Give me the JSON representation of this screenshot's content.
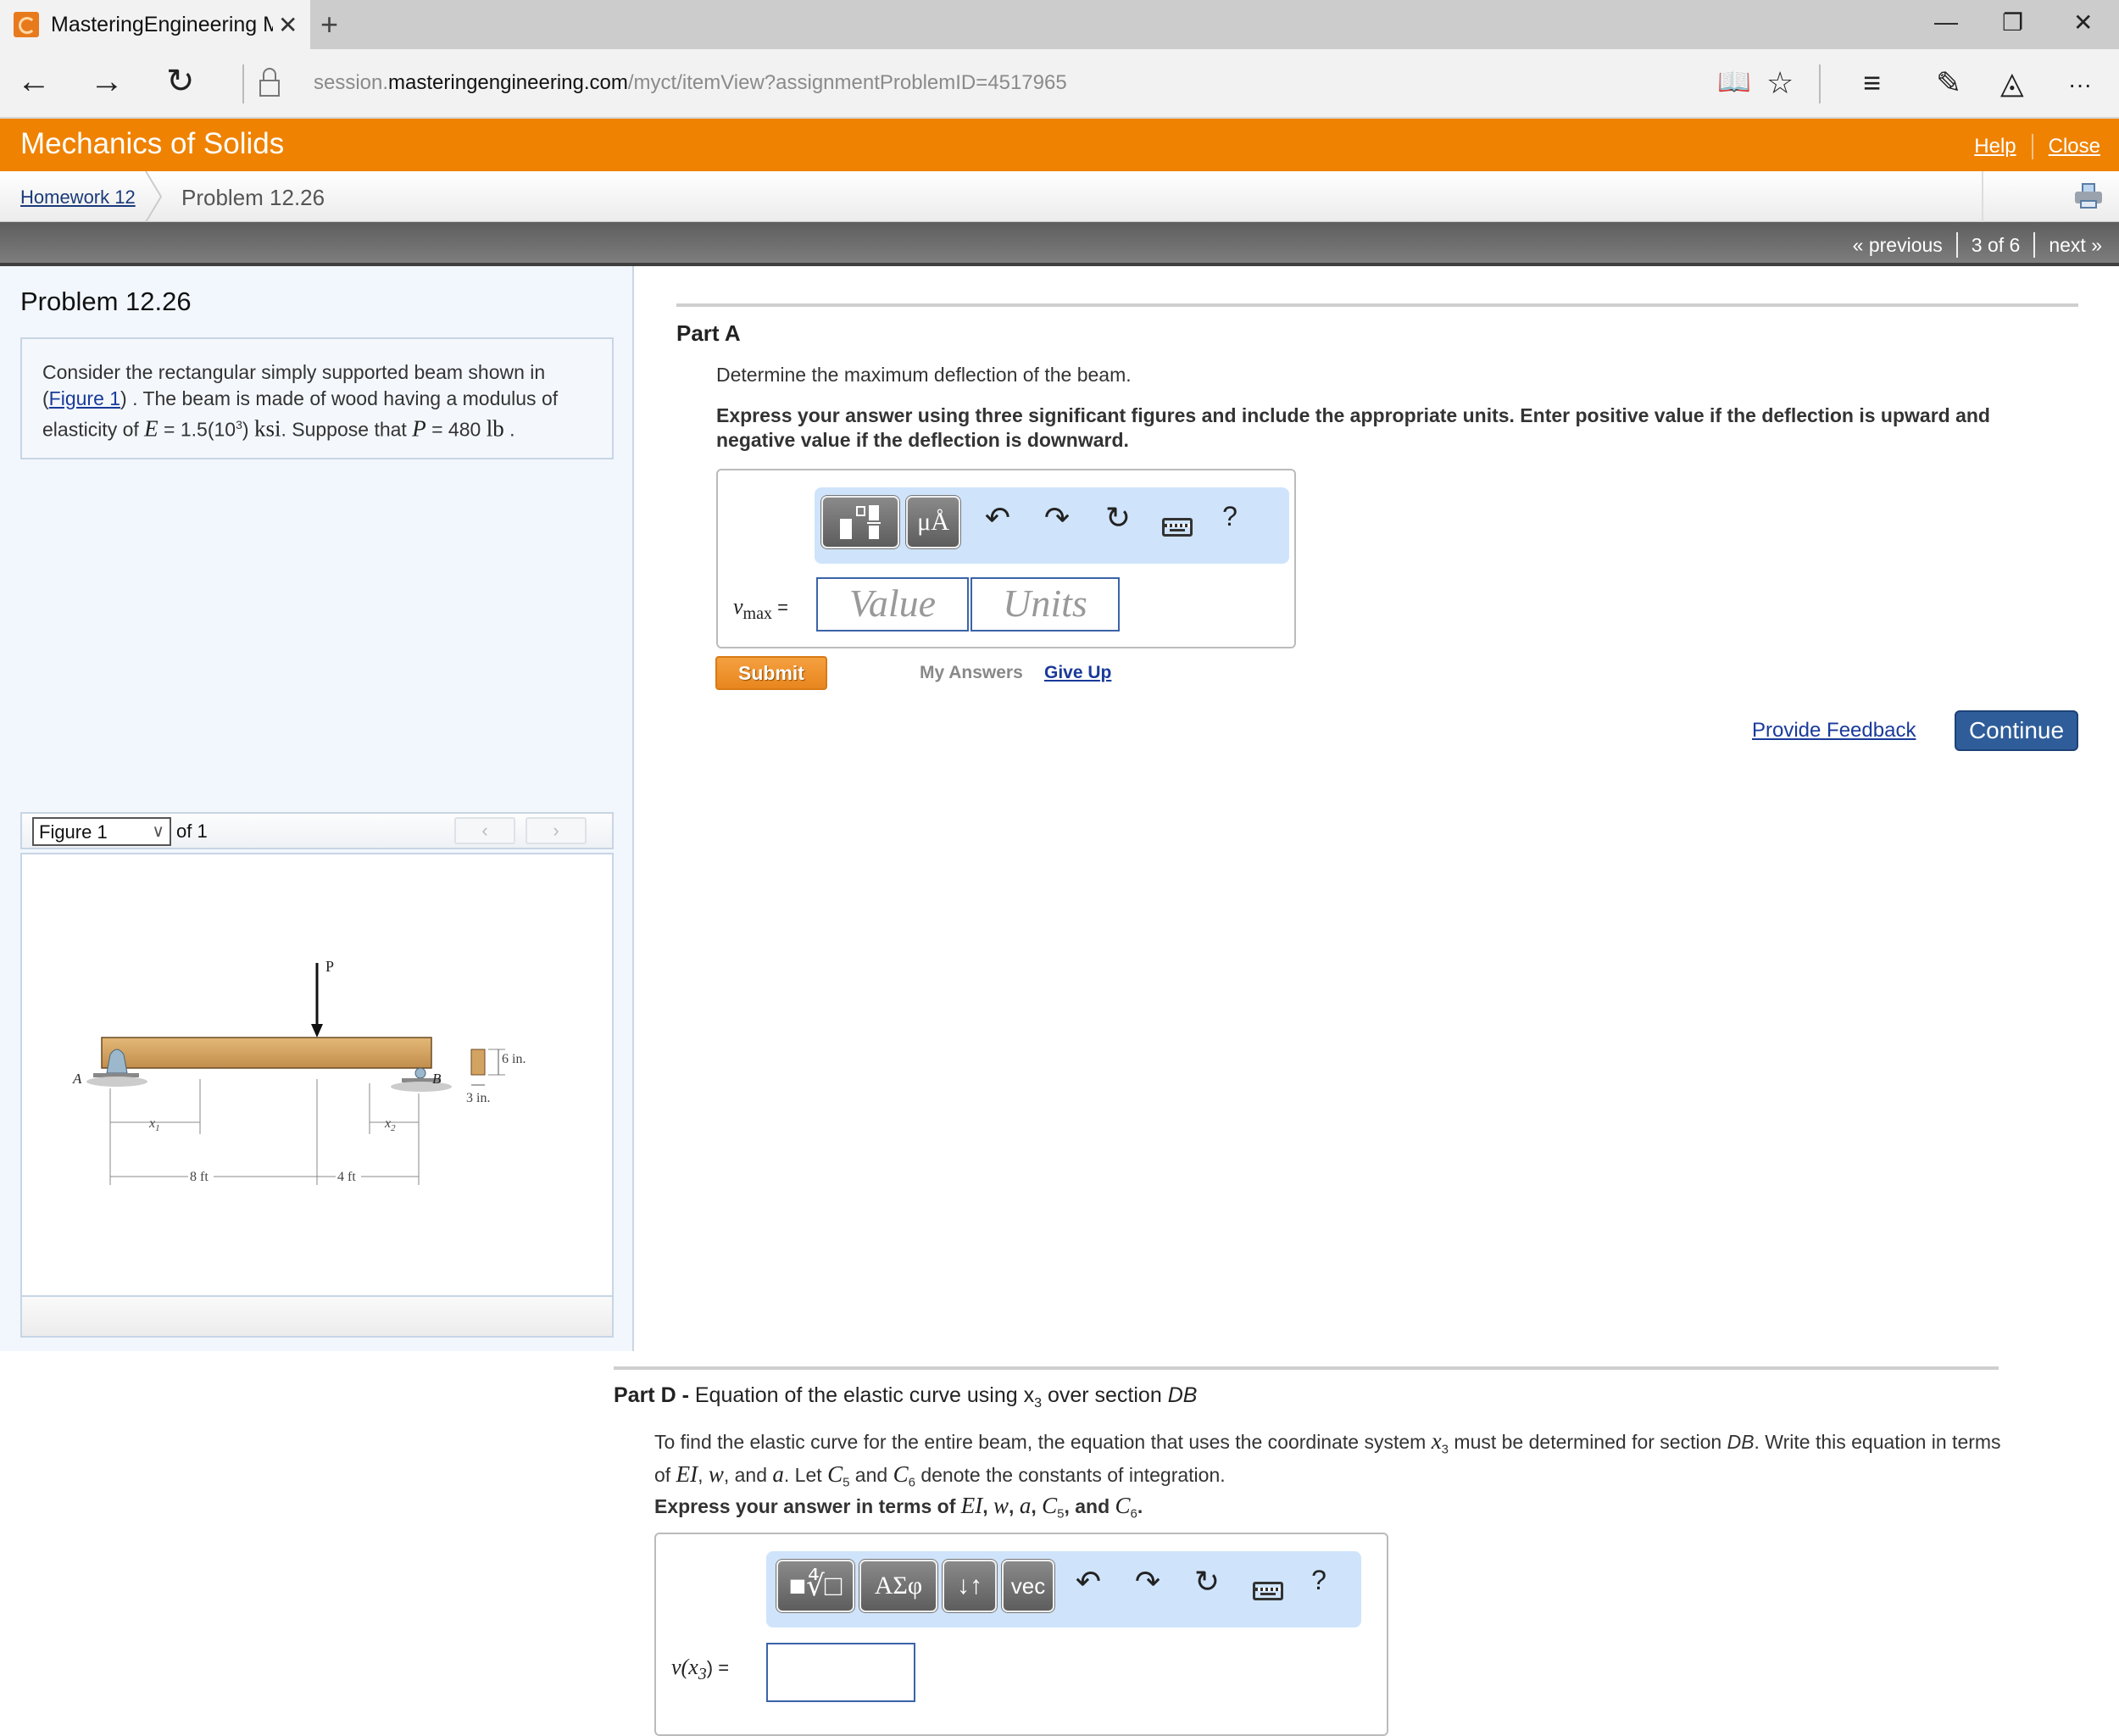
{
  "browser": {
    "tab_title": "MasteringEngineering M",
    "url_prefix": "session.",
    "url_domain": "masteringengineering.com",
    "url_path": "/myct/itemView?assignmentProblemID=4517965",
    "icons": {
      "back": "←",
      "forward": "→",
      "refresh": "↻",
      "new_tab": "+",
      "close_tab": "✕",
      "minimize": "—",
      "restore": "❐",
      "close": "✕",
      "reading": "📖",
      "favorite": "☆",
      "hub": "≡",
      "note": "✎",
      "share": "◬",
      "more": "···"
    }
  },
  "site": {
    "title": "Mechanics of Solids",
    "help": "Help",
    "close": "Close",
    "accent_color": "#ef8200"
  },
  "breadcrumb": {
    "parent": "Homework 12",
    "current": "Problem 12.26"
  },
  "pager": {
    "previous": "« previous",
    "position": "3 of 6",
    "next": "next »"
  },
  "problem": {
    "title": "Problem 12.26",
    "intro_part1": "Consider the rectangular simply supported beam shown in",
    "figure_link": "Figure 1",
    "intro_part2": ") . The beam is made of wood having a modulus of",
    "intro_part3": "elasticity of ",
    "E_symbol": "E",
    "E_value": " = 1.5(10",
    "E_exp": "3",
    "E_close": ") ",
    "E_unit": "ksi",
    "intro_part4": ". Suppose that ",
    "P_symbol": "P",
    "P_value": " = 480 ",
    "P_unit": "lb",
    "intro_end": " ."
  },
  "figure": {
    "selected": "Figure 1",
    "of_label": "of 1",
    "prev": "‹",
    "next": "›",
    "labels": {
      "load": "P",
      "support_a": "A",
      "support_b": "B",
      "x1": "x",
      "x1_sub": "1",
      "x2": "x",
      "x2_sub": "2",
      "span_left": "8 ft",
      "span_right": "4 ft",
      "height": "6 in.",
      "width": "3 in."
    }
  },
  "part_a": {
    "title": "Part A",
    "question": "Determine the maximum deflection of the beam.",
    "instruction": "Express your answer using three significant figures and include the appropriate units. Enter positive value if the deflection is upward and negative value if the deflection is downward.",
    "toolbar": {
      "templates_label": "",
      "units_label": "μÅ",
      "undo": "↶",
      "redo": "↷",
      "reset": "↻",
      "help": "?"
    },
    "answer_var": "v",
    "answer_sub": "max",
    "equals": " =",
    "value_placeholder": "Value",
    "units_placeholder": "Units",
    "submit": "Submit",
    "my_answers": "My Answers",
    "give_up": "Give Up"
  },
  "feedback": {
    "provide_feedback": "Provide Feedback",
    "continue": "Continue"
  },
  "part_d": {
    "title": "Part D - ",
    "subtitle_a": "Equation of the elastic curve using x",
    "subtitle_sub": "3",
    "subtitle_b": " over section ",
    "subtitle_c": "DB",
    "text_a": "To find the elastic curve for the entire beam, the equation that uses the coordinate system ",
    "text_x": "x",
    "text_xsub": "3",
    "text_b": " must be determined for section ",
    "text_db": "DB",
    "text_c": ". Write this equation in terms of ",
    "text_ei": "EI",
    "text_d": ", ",
    "text_w": "w",
    "text_e": ", and ",
    "text_a_sym": "a",
    "text_f": ". Let ",
    "text_c5": "C",
    "text_c5_sub": "5",
    "text_g": " and ",
    "text_c6": "C",
    "text_c6_sub": "6",
    "text_h": " denote the constants of integration.",
    "instruction_a": "Express your answer in terms of ",
    "instruction_b": ", and ",
    "toolbar": {
      "templates_label": "■∜□",
      "greek_label": "ΑΣφ",
      "arrows_label": "↓↑",
      "vec_label": "vec",
      "undo": "↶",
      "redo": "↷",
      "reset": "↻",
      "help": "?"
    },
    "answer_label": "v(x",
    "answer_sub": "3",
    "answer_close": ") ="
  }
}
